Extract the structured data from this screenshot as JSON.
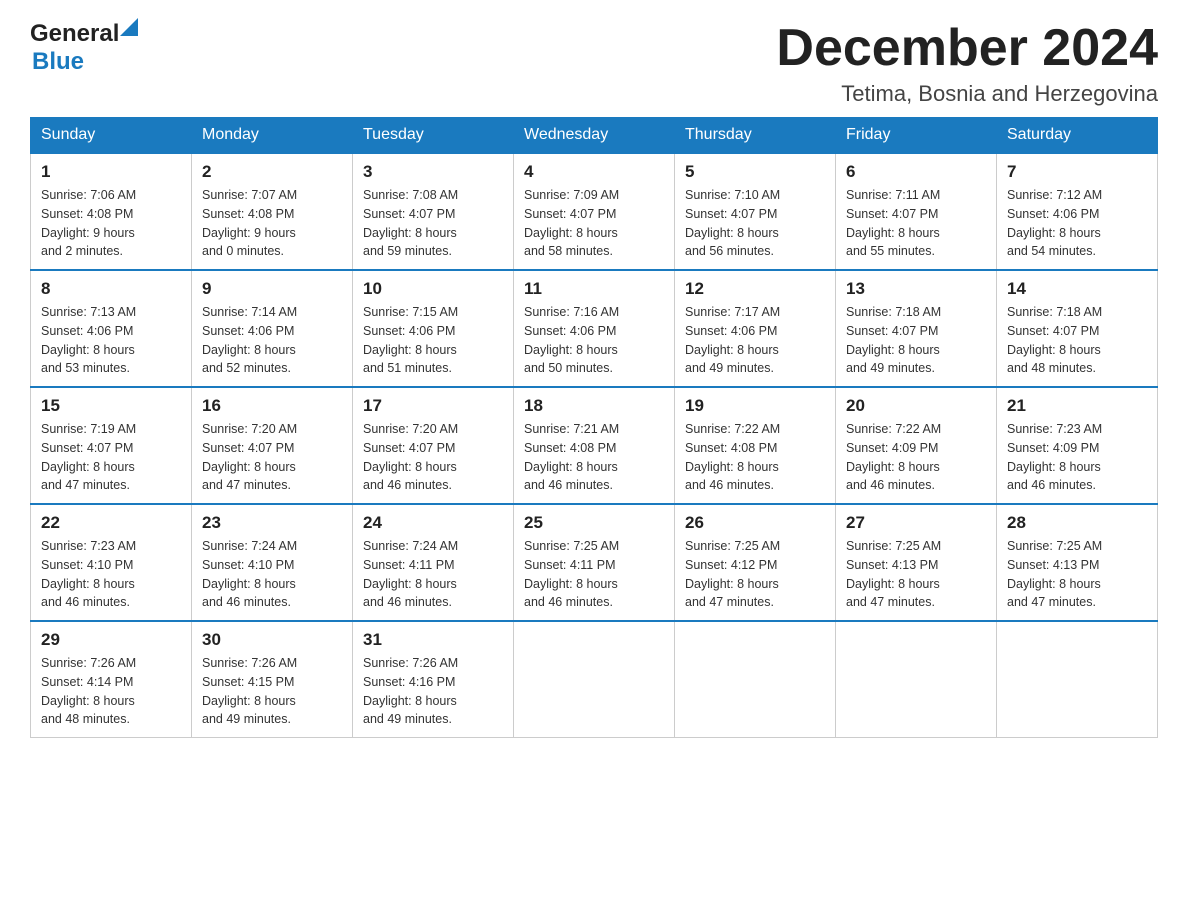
{
  "header": {
    "logo_general": "General",
    "logo_blue": "Blue",
    "month_title": "December 2024",
    "location": "Tetima, Bosnia and Herzegovina"
  },
  "weekdays": [
    "Sunday",
    "Monday",
    "Tuesday",
    "Wednesday",
    "Thursday",
    "Friday",
    "Saturday"
  ],
  "weeks": [
    [
      {
        "day": "1",
        "sunrise": "7:06 AM",
        "sunset": "4:08 PM",
        "daylight": "9 hours and 2 minutes."
      },
      {
        "day": "2",
        "sunrise": "7:07 AM",
        "sunset": "4:08 PM",
        "daylight": "9 hours and 0 minutes."
      },
      {
        "day": "3",
        "sunrise": "7:08 AM",
        "sunset": "4:07 PM",
        "daylight": "8 hours and 59 minutes."
      },
      {
        "day": "4",
        "sunrise": "7:09 AM",
        "sunset": "4:07 PM",
        "daylight": "8 hours and 58 minutes."
      },
      {
        "day": "5",
        "sunrise": "7:10 AM",
        "sunset": "4:07 PM",
        "daylight": "8 hours and 56 minutes."
      },
      {
        "day": "6",
        "sunrise": "7:11 AM",
        "sunset": "4:07 PM",
        "daylight": "8 hours and 55 minutes."
      },
      {
        "day": "7",
        "sunrise": "7:12 AM",
        "sunset": "4:06 PM",
        "daylight": "8 hours and 54 minutes."
      }
    ],
    [
      {
        "day": "8",
        "sunrise": "7:13 AM",
        "sunset": "4:06 PM",
        "daylight": "8 hours and 53 minutes."
      },
      {
        "day": "9",
        "sunrise": "7:14 AM",
        "sunset": "4:06 PM",
        "daylight": "8 hours and 52 minutes."
      },
      {
        "day": "10",
        "sunrise": "7:15 AM",
        "sunset": "4:06 PM",
        "daylight": "8 hours and 51 minutes."
      },
      {
        "day": "11",
        "sunrise": "7:16 AM",
        "sunset": "4:06 PM",
        "daylight": "8 hours and 50 minutes."
      },
      {
        "day": "12",
        "sunrise": "7:17 AM",
        "sunset": "4:06 PM",
        "daylight": "8 hours and 49 minutes."
      },
      {
        "day": "13",
        "sunrise": "7:18 AM",
        "sunset": "4:07 PM",
        "daylight": "8 hours and 49 minutes."
      },
      {
        "day": "14",
        "sunrise": "7:18 AM",
        "sunset": "4:07 PM",
        "daylight": "8 hours and 48 minutes."
      }
    ],
    [
      {
        "day": "15",
        "sunrise": "7:19 AM",
        "sunset": "4:07 PM",
        "daylight": "8 hours and 47 minutes."
      },
      {
        "day": "16",
        "sunrise": "7:20 AM",
        "sunset": "4:07 PM",
        "daylight": "8 hours and 47 minutes."
      },
      {
        "day": "17",
        "sunrise": "7:20 AM",
        "sunset": "4:07 PM",
        "daylight": "8 hours and 46 minutes."
      },
      {
        "day": "18",
        "sunrise": "7:21 AM",
        "sunset": "4:08 PM",
        "daylight": "8 hours and 46 minutes."
      },
      {
        "day": "19",
        "sunrise": "7:22 AM",
        "sunset": "4:08 PM",
        "daylight": "8 hours and 46 minutes."
      },
      {
        "day": "20",
        "sunrise": "7:22 AM",
        "sunset": "4:09 PM",
        "daylight": "8 hours and 46 minutes."
      },
      {
        "day": "21",
        "sunrise": "7:23 AM",
        "sunset": "4:09 PM",
        "daylight": "8 hours and 46 minutes."
      }
    ],
    [
      {
        "day": "22",
        "sunrise": "7:23 AM",
        "sunset": "4:10 PM",
        "daylight": "8 hours and 46 minutes."
      },
      {
        "day": "23",
        "sunrise": "7:24 AM",
        "sunset": "4:10 PM",
        "daylight": "8 hours and 46 minutes."
      },
      {
        "day": "24",
        "sunrise": "7:24 AM",
        "sunset": "4:11 PM",
        "daylight": "8 hours and 46 minutes."
      },
      {
        "day": "25",
        "sunrise": "7:25 AM",
        "sunset": "4:11 PM",
        "daylight": "8 hours and 46 minutes."
      },
      {
        "day": "26",
        "sunrise": "7:25 AM",
        "sunset": "4:12 PM",
        "daylight": "8 hours and 47 minutes."
      },
      {
        "day": "27",
        "sunrise": "7:25 AM",
        "sunset": "4:13 PM",
        "daylight": "8 hours and 47 minutes."
      },
      {
        "day": "28",
        "sunrise": "7:25 AM",
        "sunset": "4:13 PM",
        "daylight": "8 hours and 47 minutes."
      }
    ],
    [
      {
        "day": "29",
        "sunrise": "7:26 AM",
        "sunset": "4:14 PM",
        "daylight": "8 hours and 48 minutes."
      },
      {
        "day": "30",
        "sunrise": "7:26 AM",
        "sunset": "4:15 PM",
        "daylight": "8 hours and 49 minutes."
      },
      {
        "day": "31",
        "sunrise": "7:26 AM",
        "sunset": "4:16 PM",
        "daylight": "8 hours and 49 minutes."
      },
      null,
      null,
      null,
      null
    ]
  ],
  "labels": {
    "sunrise_prefix": "Sunrise: ",
    "sunset_prefix": "Sunset: ",
    "daylight_prefix": "Daylight: "
  }
}
